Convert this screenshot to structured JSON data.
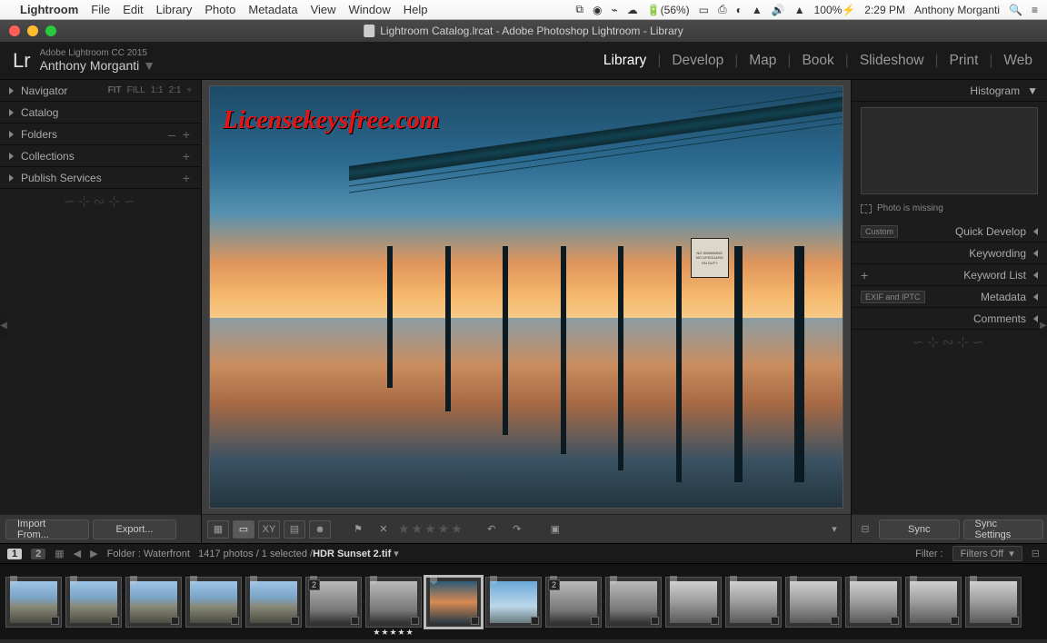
{
  "menubar": {
    "app": "Lightroom",
    "items": [
      "File",
      "Edit",
      "Library",
      "Photo",
      "Metadata",
      "View",
      "Window",
      "Help"
    ],
    "tray": {
      "battery": "(56%)",
      "charge": "100%",
      "time": "2:29 PM",
      "user": "Anthony Morganti"
    }
  },
  "window": {
    "title": "Lightroom Catalog.lrcat - Adobe Photoshop Lightroom - Library"
  },
  "header": {
    "edition": "Adobe Lightroom CC 2015",
    "owner": "Anthony Morganti",
    "modules": [
      "Library",
      "Develop",
      "Map",
      "Book",
      "Slideshow",
      "Print",
      "Web"
    ],
    "active": "Library"
  },
  "left": {
    "navigator": {
      "label": "Navigator",
      "opts": [
        "FIT",
        "FILL",
        "1:1",
        "2:1"
      ]
    },
    "rows": [
      {
        "label": "Catalog"
      },
      {
        "label": "Folders",
        "pm": "– +"
      },
      {
        "label": "Collections",
        "pm": "+"
      },
      {
        "label": "Publish Services",
        "pm": "+"
      }
    ],
    "import": "Import From...",
    "export": "Export..."
  },
  "right": {
    "histogram": "Histogram",
    "missing": "Photo is missing",
    "rows": [
      {
        "label": "Quick Develop",
        "sel": "Custom"
      },
      {
        "label": "Keywording"
      },
      {
        "label": "Keyword List",
        "plus": "+"
      },
      {
        "label": "Metadata",
        "sel": "EXIF and IPTC"
      },
      {
        "label": "Comments"
      }
    ],
    "sync": "Sync",
    "sync_settings": "Sync Settings"
  },
  "watermark": "Licensekeysfree.com",
  "sign": [
    "NO SWIMMING",
    "NO LIFEGUARD",
    "ON DUTY"
  ],
  "bbar": {
    "src1": "1",
    "src2": "2",
    "folder_lbl": "Folder :",
    "folder": "Waterfront",
    "count": "1417 photos / 1 selected /",
    "file": "HDR Sunset 2.tif",
    "filter_lbl": "Filter :",
    "filter": "Filters Off"
  },
  "filmstrip": {
    "thumbs": [
      {
        "cls": "th-city"
      },
      {
        "cls": "th-city"
      },
      {
        "cls": "th-city"
      },
      {
        "cls": "th-city"
      },
      {
        "cls": "th-city"
      },
      {
        "cls": "th-bw",
        "stack": "2"
      },
      {
        "cls": "th-bw",
        "rated": true
      },
      {
        "cls": "th-sun",
        "sel": true
      },
      {
        "cls": "th-blue"
      },
      {
        "cls": "th-bw",
        "stack": "2"
      },
      {
        "cls": "th-bw"
      },
      {
        "cls": "th-gr"
      },
      {
        "cls": "th-gr"
      },
      {
        "cls": "th-gr"
      },
      {
        "cls": "th-gr"
      },
      {
        "cls": "th-gr"
      },
      {
        "cls": "th-gr"
      }
    ]
  }
}
